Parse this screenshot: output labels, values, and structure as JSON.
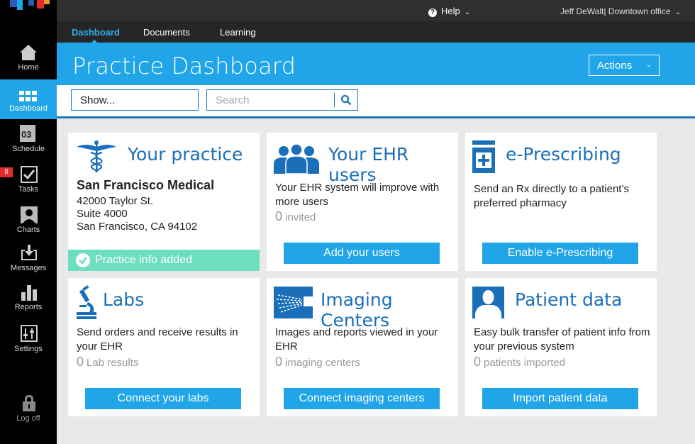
{
  "brand": {
    "colors": [
      "#1fa5e8",
      "#e32b2b",
      "#2b5db5",
      "#f09a2a"
    ]
  },
  "colors": {
    "accent": "#1fa5e8",
    "title_blue": "#1a6fb8",
    "success": "#6bdfbe",
    "badge": "#e32b2b"
  },
  "sidebar": {
    "items": [
      {
        "label": "Home",
        "icon": "home-icon"
      },
      {
        "label": "Dashboard",
        "icon": "dashboard-grid-icon",
        "active": true
      },
      {
        "label": "Schedule",
        "icon": "calendar-icon",
        "icon_text": "03"
      },
      {
        "label": "Tasks",
        "icon": "checkbox-icon",
        "badge": "8"
      },
      {
        "label": "Charts",
        "icon": "person-chart-icon"
      },
      {
        "label": "Messages",
        "icon": "inbox-icon"
      },
      {
        "label": "Reports",
        "icon": "bar-chart-icon"
      },
      {
        "label": "Settings",
        "icon": "sliders-icon"
      },
      {
        "label": "Log off",
        "icon": "lock-icon"
      }
    ]
  },
  "topbar": {
    "help_label": "Help",
    "user_label": "Jeff DeWalt| Downtown office"
  },
  "tabs": [
    {
      "label": "Dashboard",
      "active": true
    },
    {
      "label": "Documents"
    },
    {
      "label": "Learning"
    }
  ],
  "header": {
    "title": "Practice Dashboard",
    "actions_label": "Actions"
  },
  "filter": {
    "show_label": "Show...",
    "search_placeholder": "Search"
  },
  "cards": {
    "practice": {
      "title": "Your practice",
      "icon": "caduceus-icon",
      "name": "San Francisco Medical",
      "address": [
        "42000 Taylor St.",
        "Suite 4000",
        "San Francisco, CA 94102"
      ],
      "status": "Practice info added"
    },
    "ehr_users": {
      "title": "Your EHR users",
      "icon": "users-group-icon",
      "text": "Your EHR system will improve with more users",
      "count": "0",
      "count_label": "invited",
      "button": "Add your users"
    },
    "eprescribing": {
      "title": "e-Prescribing",
      "icon": "prescription-bottle-icon",
      "text": "Send an Rx directly to a patient’s preferred pharmacy",
      "button": "Enable e-Prescribing"
    },
    "labs": {
      "title": "Labs",
      "icon": "microscope-icon",
      "text": "Send orders and receive results in your EHR",
      "count": "0",
      "count_label": "Lab results",
      "button": "Connect your labs"
    },
    "imaging": {
      "title": "Imaging Centers",
      "icon": "imaging-scanner-icon",
      "text": "Images and reports viewed in your EHR",
      "count": "0",
      "count_label": "imaging centers",
      "button": "Connect imaging centers"
    },
    "patient_data": {
      "title": "Patient data",
      "icon": "patient-silhouette-icon",
      "text": "Easy bulk transfer of patient info from your previous system",
      "count": "0",
      "count_label": "patients imported",
      "button": "Import patient data"
    }
  }
}
